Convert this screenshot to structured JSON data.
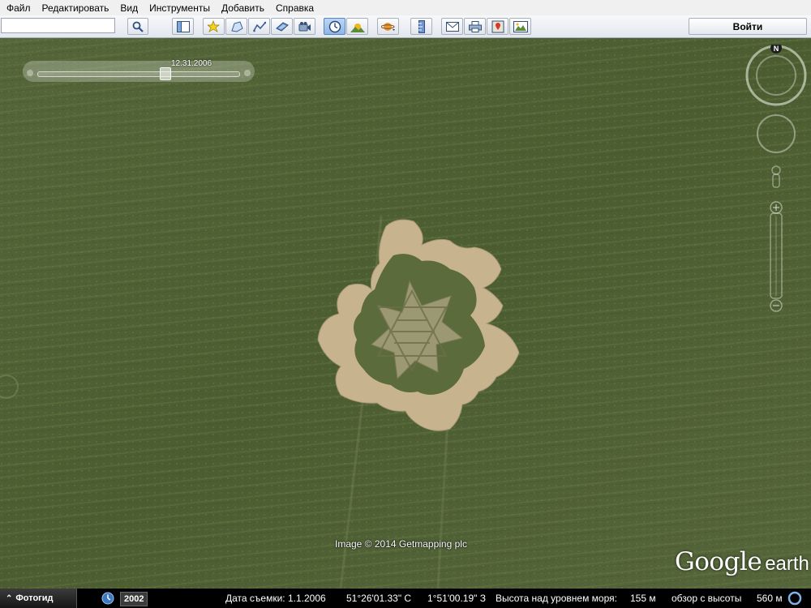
{
  "menu": [
    "Файл",
    "Редактировать",
    "Вид",
    "Инструменты",
    "Добавить",
    "Справка"
  ],
  "toolbar": {
    "search_value": "",
    "login_label": "Войти",
    "buttons": [
      "search-icon",
      "sidebar-toggle-icon",
      "placemark-icon",
      "polygon-icon",
      "path-icon",
      "image-overlay-icon",
      "record-tour-icon",
      "historical-imagery-icon",
      "sunlight-icon",
      "planet-icon",
      "ruler-icon",
      "email-icon",
      "print-icon",
      "google-maps-icon",
      "save-image-icon"
    ]
  },
  "map": {
    "time_slider": {
      "date": "12.31.2006",
      "position": 0.63
    },
    "compass": {
      "north_label": "N"
    },
    "attribution": "Image © 2014 Getmapping plc",
    "logo": {
      "word1": "Google",
      "word2": "earth"
    },
    "colors": {
      "field": "#4d5f2f",
      "crop_circle": "#c9b690"
    }
  },
  "statusbar": {
    "tour_guide_label": "Фотогид",
    "year": "2002",
    "imagery_date": "Дата съемки: 1.1.2006",
    "latitude": "51°26'01.33\" С",
    "longitude": "1°51'00.19\" З",
    "elevation_label": "Высота над уровнем моря:",
    "elevation_value": "155 м",
    "eye_alt_label": "обзор с высоты",
    "eye_alt_value": "560 м"
  }
}
